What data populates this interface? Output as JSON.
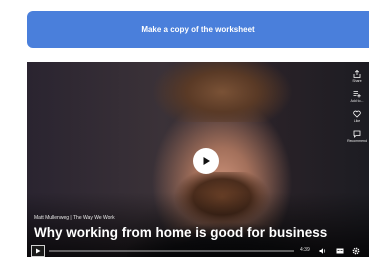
{
  "copy_button": {
    "label": "Make a copy of the worksheet"
  },
  "video": {
    "byline": "Matt Mullenweg | The Way We Work",
    "title": "Why working from home is good for business",
    "duration": "4:39",
    "progress": 0,
    "side_actions": [
      {
        "label": "Share",
        "icon": "share-icon"
      },
      {
        "label": "Add to...",
        "icon": "add-to-list-icon"
      },
      {
        "label": "Like",
        "icon": "heart-icon"
      },
      {
        "label": "Recommend",
        "icon": "recommend-icon"
      }
    ]
  },
  "colors": {
    "accent": "#4a7fdb",
    "player_bg": "#2a2430"
  }
}
